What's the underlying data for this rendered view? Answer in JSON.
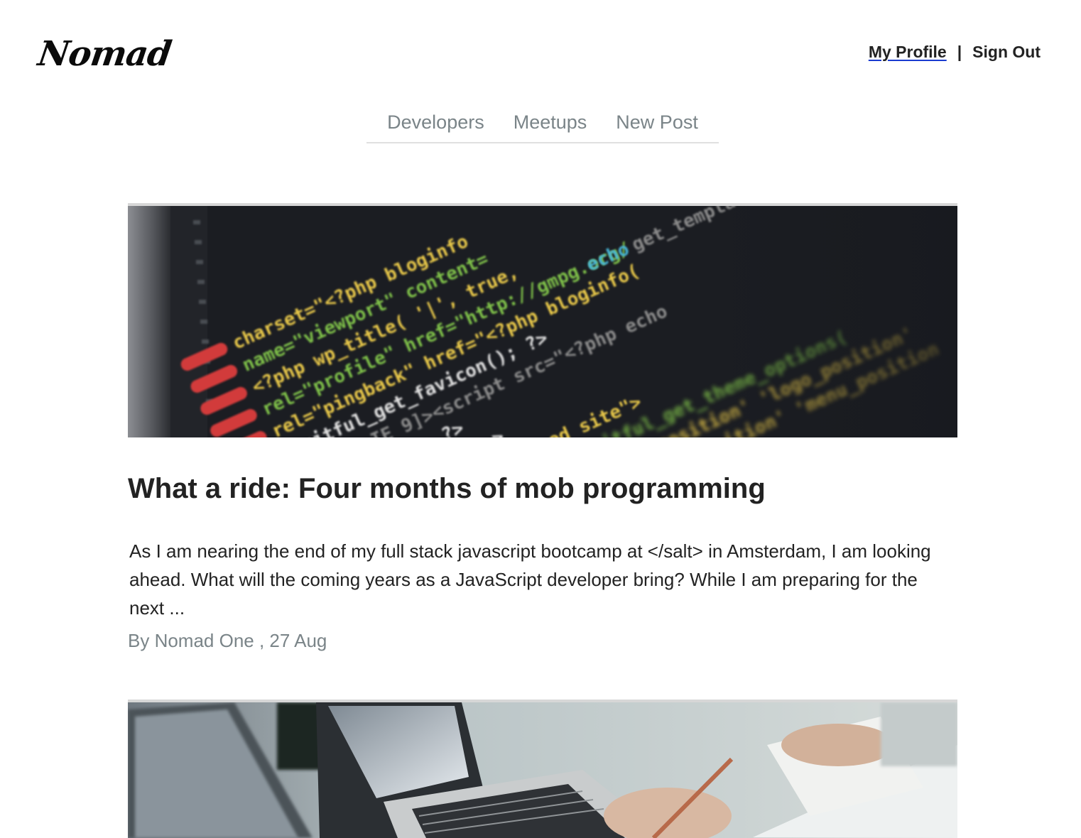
{
  "header": {
    "logo": "Nomad",
    "links": {
      "profile": "My Profile",
      "separator": "|",
      "sign_out": "Sign Out"
    }
  },
  "nav": {
    "items": [
      {
        "label": "Developers"
      },
      {
        "label": "Meetups"
      },
      {
        "label": "New Post"
      }
    ]
  },
  "posts": [
    {
      "title": "What a ride: Four months of mob programming",
      "excerpt": "As I am nearing the end of my full stack javascript bootcamp at </salt> in Amsterdam, I am looking ahead. What will the coming years as a JavaScript developer bring? While I am preparing for the next ...",
      "author": "By Nomad One",
      "date_sep": " , ",
      "date": "27 Aug",
      "image": "code-screen-photo"
    },
    {
      "image": "laptop-desk-photo"
    }
  ],
  "colors": {
    "nav_text": "#7a8488",
    "meta_text": "#7a8488",
    "link_underline": "#1a3bd0",
    "image_border": "#d7d7d7"
  }
}
